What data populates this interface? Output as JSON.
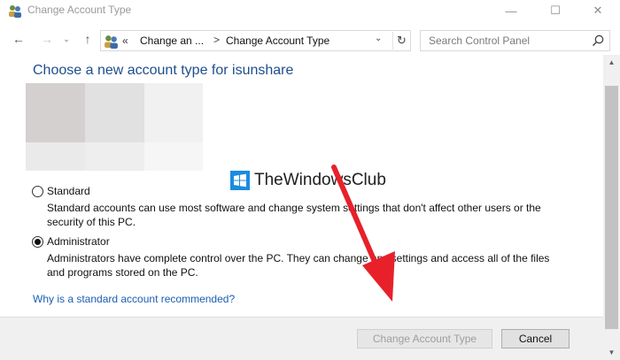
{
  "window": {
    "title": "Change Account Type",
    "minimize_glyph": "—",
    "maximize_glyph": "☐",
    "close_glyph": "✕"
  },
  "nav": {
    "back_glyph": "←",
    "forward_glyph": "→",
    "recent_glyph": "⌄",
    "up_glyph": "↑"
  },
  "address": {
    "chevron": "«",
    "crumb1": "Change an ...",
    "separator": ">",
    "crumb2": "Change Account Type",
    "dropdown_glyph": "⌄",
    "refresh_glyph": "↻"
  },
  "search": {
    "placeholder": "Search Control Panel"
  },
  "main": {
    "heading": "Choose a new account type for isunshare",
    "options": [
      {
        "label": "Standard",
        "checked": false,
        "description_line1": "Standard accounts can use most software and change system settings that don't affect other users or the",
        "description_line2": "security of this PC."
      },
      {
        "label": "Administrator",
        "checked": true,
        "description_line1": "Administrators have complete control over the PC. They can change any settings and access all of the files",
        "description_line2": "and programs stored on the PC."
      }
    ],
    "help_link": "Why is a standard account recommended?"
  },
  "watermark": {
    "text": "TheWindowsClub"
  },
  "footer": {
    "change_button": "Change Account Type",
    "cancel_button": "Cancel"
  },
  "scrollbar": {
    "up_glyph": "▲",
    "down_glyph": "▼"
  },
  "colors": {
    "heading": "#1e4e8c",
    "link": "#1a5fb4",
    "arrow": "#e8202a",
    "watermark_logo": "#1a8ce0"
  },
  "icons": [
    "users-icon",
    "search-icon",
    "refresh-icon",
    "windows-logo-icon",
    "red-arrow-annotation"
  ]
}
